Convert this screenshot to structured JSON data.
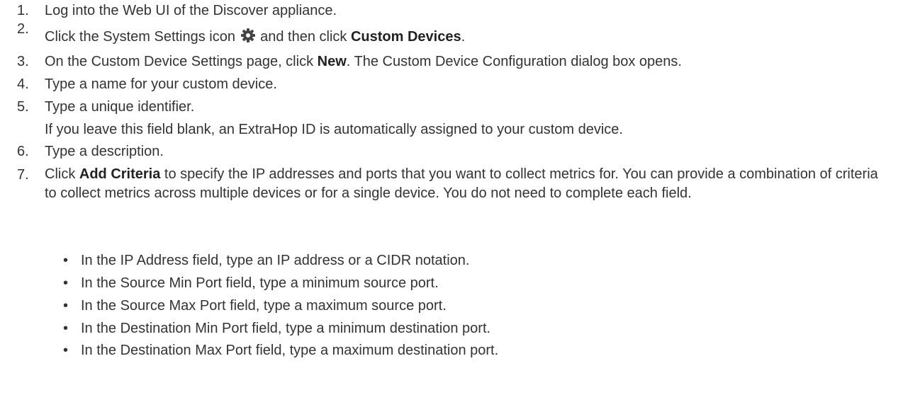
{
  "steps": [
    {
      "number": "1.",
      "text": "Log into the Web UI of the Discover appliance."
    },
    {
      "number": "2.",
      "before": "Click the System Settings icon ",
      "icon": "gear-icon",
      "after": " and then click ",
      "bold": "Custom Devices",
      "end": "."
    },
    {
      "number": "3.",
      "before": "On the Custom Device Settings page, click ",
      "bold": "New",
      "after": ". The Custom Device Configuration dialog box opens."
    },
    {
      "number": "4.",
      "text": "Type a name for your custom device."
    },
    {
      "number": "5.",
      "text": "Type a unique identifier.",
      "continuation": "If you leave this field blank, an ExtraHop ID is automatically assigned to your custom device."
    },
    {
      "number": "6.",
      "text": "Type a description."
    },
    {
      "number": "7.",
      "before": "Click ",
      "bold": "Add Criteria",
      "after": " to specify the IP addresses and ports that you want to collect metrics for. You can provide a combination of criteria to collect metrics across multiple devices or for a single device. You do not need to complete each field."
    }
  ],
  "bullets": [
    "In the IP Address field, type an IP address or a CIDR notation.",
    "In the Source Min Port field, type a minimum source port.",
    "In the Source Max Port field, type a maximum source port.",
    "In the Destination Min Port field, type a minimum destination port.",
    "In the Destination Max Port field, type a maximum destination port."
  ],
  "bullet_glyph": "•"
}
